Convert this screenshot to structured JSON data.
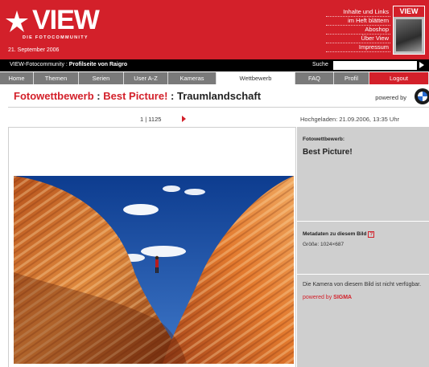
{
  "header": {
    "logo_text": "VIEW",
    "logo_sub": "DIE FOTOCOMMUNITY",
    "date": "21. September 2006",
    "links": [
      "Inhalte und Links",
      "im Heft blättern",
      "Aboshop",
      "Über View",
      "Impressum"
    ],
    "magazine_title": "VIEW"
  },
  "topbar": {
    "crumb_prefix": "VIEW-Fotocommunity :",
    "crumb_page": "Profilseite von Raigro",
    "search_label": "Suche",
    "search_value": ""
  },
  "nav": {
    "tabs": [
      "Home",
      "Themen",
      "Serien",
      "User A-Z",
      "Kameras",
      "Wettbewerb",
      "FAQ",
      "Profil",
      "Logout"
    ]
  },
  "title": {
    "part1": "Fotowettbewerb",
    "sep1": " : ",
    "part2": "Best Picture!",
    "sep2": " : ",
    "part3": "Traumlandschaft",
    "powered_by": "powered by"
  },
  "pager": {
    "text": "1 | 1125",
    "uploaded": "Hochgeladen: 21.09.2006, 13:35 Uhr"
  },
  "sidebar": {
    "contest_label": "Fotowettbewerb:",
    "contest_name": "Best Picture!",
    "meta_label": "Metadaten zu diesem Bild",
    "meta_help": "?",
    "size": "Größe: 1024×687",
    "camera_note": "Die Kamera von diesem Bild ist nicht verfügbar.",
    "powered_prefix": "powered by",
    "powered_brand": "SIGMA"
  },
  "colors": {
    "brand_red": "#d3202a",
    "nav_gray": "#7a7a7a",
    "sidebar_gray": "#cfcfcf"
  }
}
